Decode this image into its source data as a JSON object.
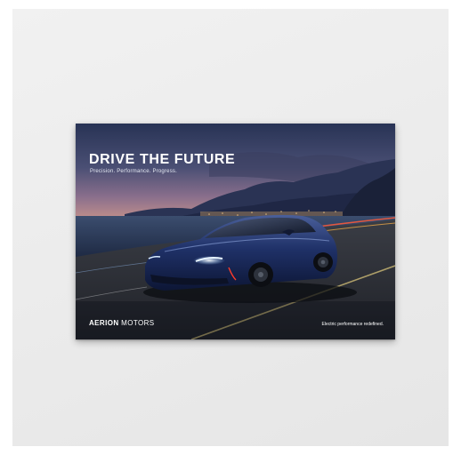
{
  "poster": {
    "headline": "DRIVE THE FUTURE",
    "subheadline": "Precision. Performance. Progress.",
    "brand_bold": "AERION",
    "brand_light": "MOTORS",
    "tagline": "Electric performance redefined."
  },
  "colors": {
    "background": "#ebebeb",
    "sky_top": "#2b3658",
    "sky_horizon": "#8a6f8c",
    "car_body": "#1d2e63",
    "headlights": "#cfe6ff",
    "taillights": "#ff3b2a",
    "road": "#2e3137"
  }
}
